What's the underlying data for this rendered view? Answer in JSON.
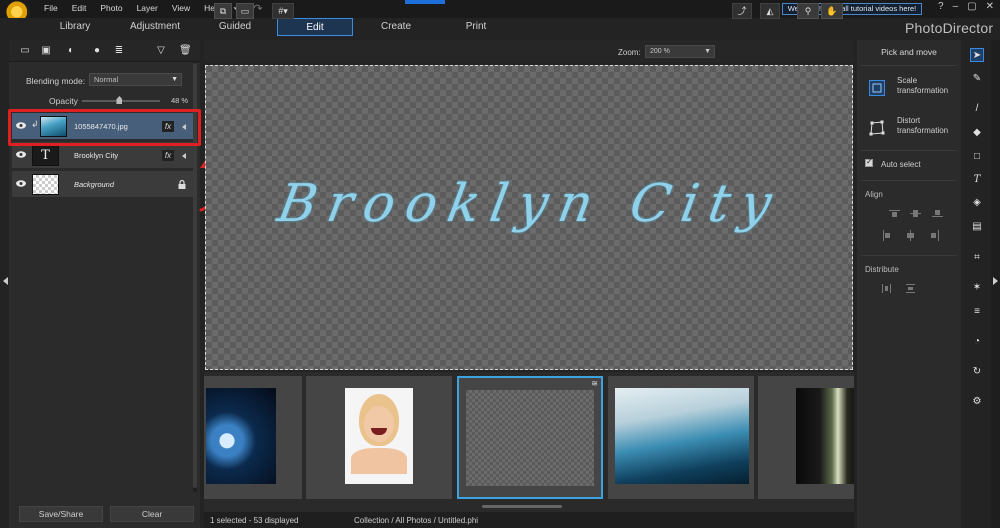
{
  "menu": [
    "File",
    "Edit",
    "Photo",
    "Layer",
    "View",
    "Help"
  ],
  "welcome": "Welcome! View all tutorial videos here!",
  "window_controls": [
    "?",
    "–",
    "▢",
    "✕"
  ],
  "tabs": [
    {
      "label": "Library"
    },
    {
      "label": "Adjustment"
    },
    {
      "label": "Guided"
    },
    {
      "label": "Edit"
    },
    {
      "label": "Create"
    },
    {
      "label": "Print"
    }
  ],
  "brand": "PhotoDirector",
  "left_panel": {
    "blending_label": "Blending mode:",
    "blending_value": "Normal",
    "opacity_label": "Opacity",
    "opacity_value": "48 %",
    "opacity_fraction": 0.48,
    "layers": [
      {
        "name": "1055847470.jpg",
        "fx": "fx",
        "selected": true
      },
      {
        "name": "Brooklyn City",
        "fx": "fx",
        "selected": false
      },
      {
        "name": "Background",
        "fx": "",
        "selected": false
      }
    ],
    "save_share": "Save/Share",
    "clear": "Clear"
  },
  "canvas": {
    "zoom_label": "Zoom:",
    "zoom_value": "200 %",
    "text": "Brooklyn City"
  },
  "status": {
    "selected": "1 selected - 53 displayed",
    "path": "Collection / All Photos / Untitled.phi"
  },
  "right_panel": {
    "title": "Pick and move",
    "scale": "Scale transformation",
    "distort": "Distort transformation",
    "auto_select": "Auto select",
    "align": "Align",
    "distribute": "Distribute"
  },
  "colors": {
    "accent": "#3b8be0",
    "canvas_text": "#8fd1ea",
    "annotation": "#e02020"
  }
}
